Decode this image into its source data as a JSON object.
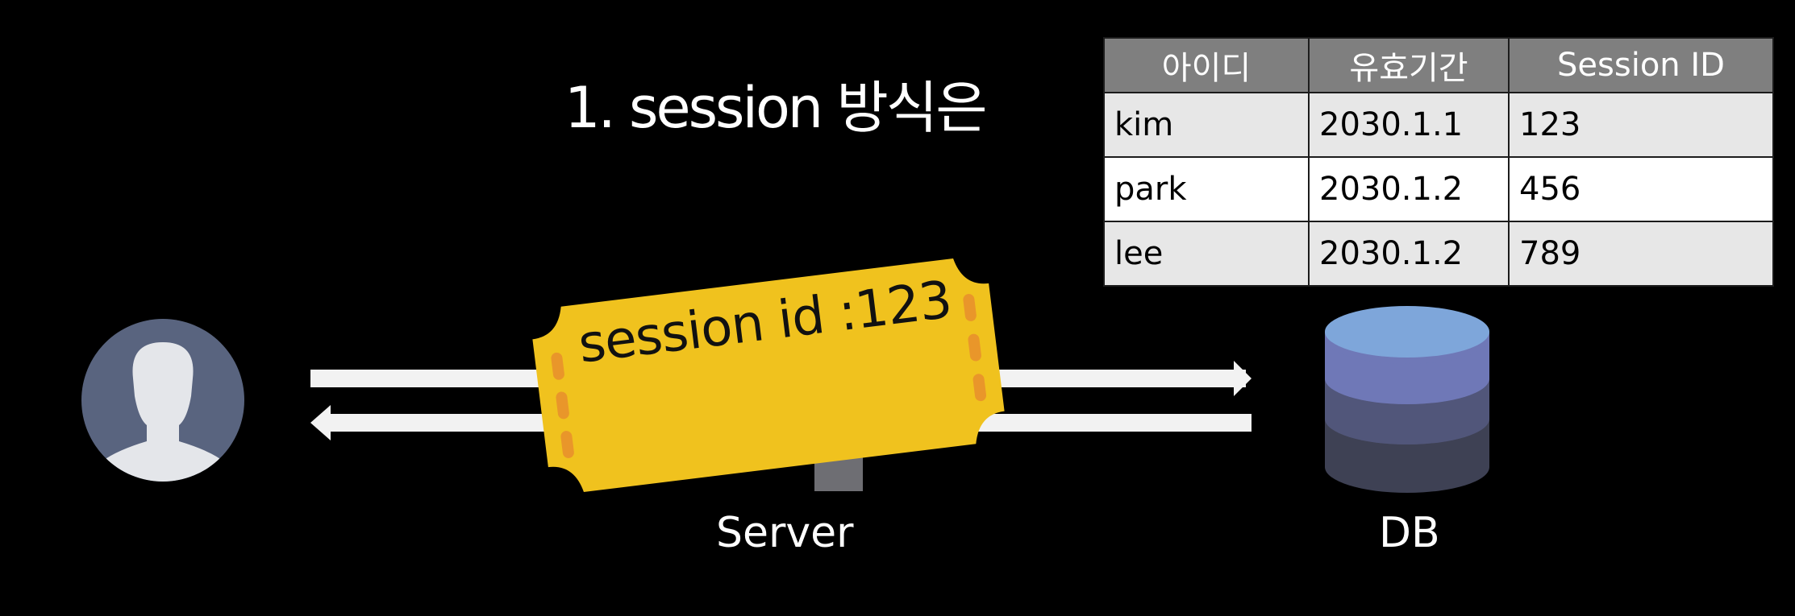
{
  "title": "1. session 방식은",
  "table": {
    "headers": [
      "아이디",
      "유효기간",
      "Session ID"
    ],
    "rows": [
      [
        "kim",
        "2030.1.1",
        "123"
      ],
      [
        "park",
        "2030.1.2",
        "456"
      ],
      [
        "lee",
        "2030.1.2",
        "789"
      ]
    ]
  },
  "ticket": {
    "text": "session id :123"
  },
  "labels": {
    "server": "Server",
    "db": "DB"
  },
  "icons": {
    "user": "user-avatar-icon",
    "server": "server-icon",
    "database": "database-icon",
    "ticket": "ticket-icon",
    "arrows": [
      "arrow-right-icon",
      "arrow-left-icon"
    ]
  },
  "colors": {
    "background": "#000000",
    "ticket": "#F0C21E",
    "ticket_notch": "#E9962A",
    "avatar_bg": "#59647F",
    "db_top": "#7EA6DA",
    "db_mid": "#6F78B7"
  }
}
